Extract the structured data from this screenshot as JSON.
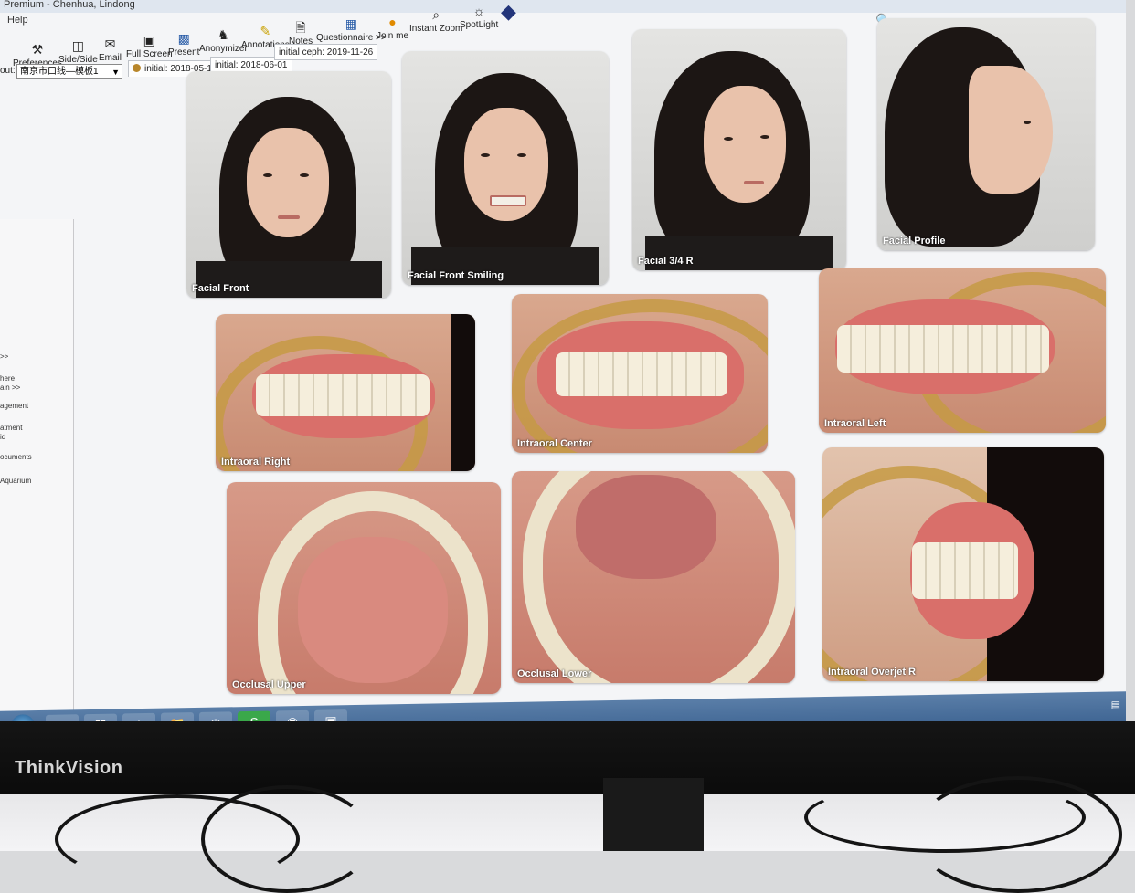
{
  "window": {
    "title": "Premium - Chenhua, Lindong"
  },
  "menu": {
    "items": [
      "Help"
    ]
  },
  "toolbar": {
    "buttons": [
      {
        "label": "Preferences",
        "icon": "wrench-icon"
      },
      {
        "label": "Side/Side",
        "icon": "side-by-side-icon"
      },
      {
        "label": "Email",
        "icon": "email-icon"
      },
      {
        "label": "Full Screen",
        "icon": "fullscreen-icon"
      },
      {
        "label": "Present",
        "icon": "present-icon"
      },
      {
        "label": "Anonymizer",
        "icon": "anonymizer-icon"
      },
      {
        "label": "Annotations",
        "icon": "annotations-icon"
      },
      {
        "label": "Notes",
        "icon": "notes-icon"
      },
      {
        "label": "Questionnaire >>",
        "icon": "questionnaire-icon"
      },
      {
        "label": "Join me",
        "icon": "join-me-icon"
      },
      {
        "label": "Instant Zoom",
        "icon": "zoom-icon"
      },
      {
        "label": "SpotLight",
        "icon": "spotlight-icon"
      }
    ]
  },
  "layout": {
    "label": "out:",
    "selected": "南京市口线—模板1"
  },
  "tabs": [
    {
      "label": "initial: 2018-05-13",
      "active": true
    },
    {
      "label": "initial: 2018-06-01",
      "active": false
    },
    {
      "label": "initial ceph: 2019-11-26",
      "active": false
    }
  ],
  "sidebar": {
    "items": [
      ">>",
      "here",
      "ain >>",
      "agement",
      "atment",
      "id",
      "ocuments",
      "Aquarium"
    ]
  },
  "photos": [
    {
      "caption": "Facial Front"
    },
    {
      "caption": "Facial Front Smiling"
    },
    {
      "caption": "Facial 3/4 R"
    },
    {
      "caption": "Facial Profile"
    },
    {
      "caption": "Intraoral Right"
    },
    {
      "caption": "Intraoral Center"
    },
    {
      "caption": "Intraoral Left"
    },
    {
      "caption": "Occlusal Upper"
    },
    {
      "caption": "Occlusal Lower"
    },
    {
      "caption": "Intraoral Overjet R"
    }
  ],
  "monitor": {
    "brand": "ThinkVision"
  },
  "colors": {
    "taskbar": "#3f6593",
    "retractor": "#c59a44",
    "screen_bg": "#f4f5f7"
  }
}
